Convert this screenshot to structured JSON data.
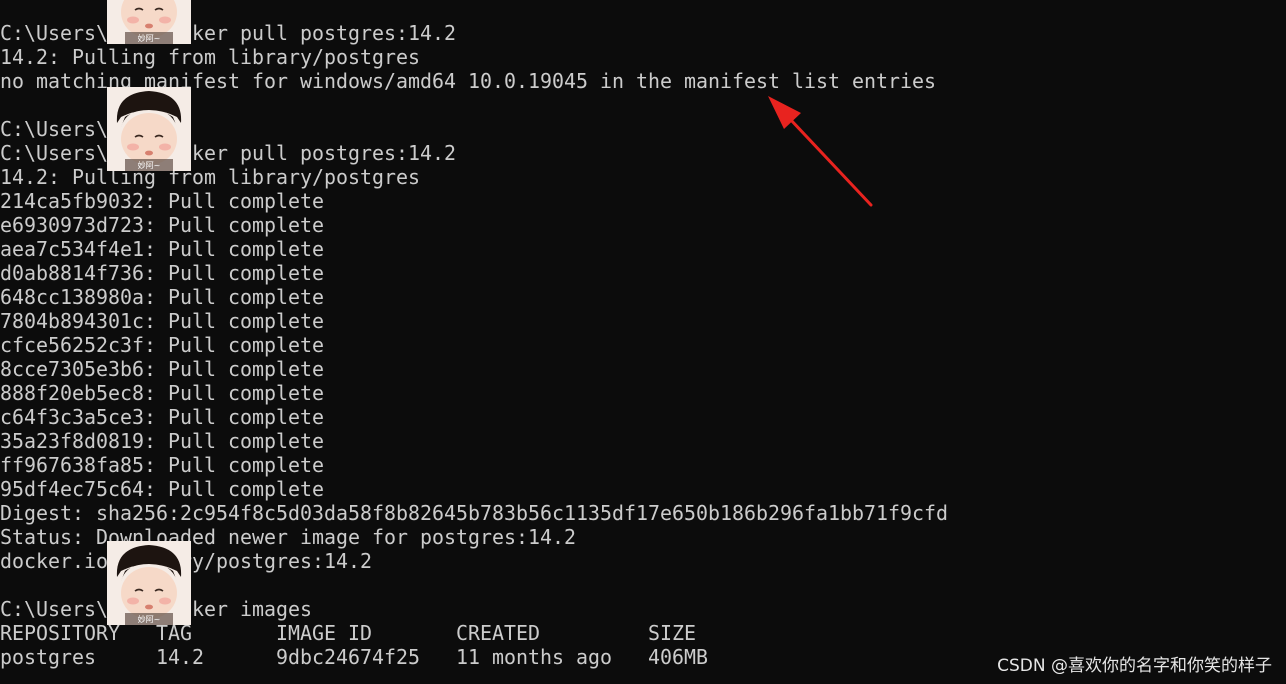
{
  "terminal": {
    "lines": [
      "C:\\Users\\ 72>docker pull postgres:14.2",
      "14.2: Pulling from library/postgres",
      "no matching manifest for windows/amd64 10.0.19045 in the manifest list entries",
      "",
      "C:\\Users\\ 72>",
      "C:\\Users\\ 72>docker pull postgres:14.2",
      "14.2: Pulling from library/postgres",
      "214ca5fb9032: Pull complete",
      "e6930973d723: Pull complete",
      "aea7c534f4e1: Pull complete",
      "d0ab8814f736: Pull complete",
      "648cc138980a: Pull complete",
      "7804b894301c: Pull complete",
      "cfce56252c3f: Pull complete",
      "8cce7305e3b6: Pull complete",
      "888f20eb5ec8: Pull complete",
      "c64f3c3a5ce3: Pull complete",
      "35a23f8d0819: Pull complete",
      "ff967638fa85: Pull complete",
      "95df4ec75c64: Pull complete",
      "Digest: sha256:2c954f8c5d03da58f8b82645b783b56c1135df17e650b186b296fa1bb71f9cfd",
      "Status: Downloaded newer image for postgres:14.2",
      "docker.io/library/postgres:14.2",
      "",
      "C:\\Users\\ 72>docker images",
      "REPOSITORY   TAG       IMAGE ID       CREATED         SIZE",
      "postgres     14.2      9dbc24674f25   11 months ago   406MB"
    ]
  },
  "stickers": {
    "caption": "妙阿~"
  },
  "watermark": {
    "text": "CSDN @喜欢你的名字和你笑的样子"
  },
  "colors": {
    "background": "#0c0c0c",
    "text": "#cccccc",
    "arrow": "#e8231f"
  }
}
